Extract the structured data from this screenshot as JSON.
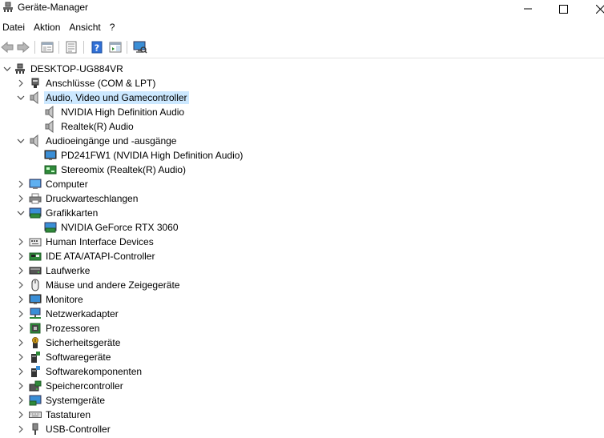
{
  "window": {
    "title": "Geräte-Manager"
  },
  "menu": [
    "Datei",
    "Aktion",
    "Ansicht",
    "?"
  ],
  "tree": {
    "root": "DESKTOP-UG884VR",
    "categories": [
      {
        "label": "Anschlüsse (COM & LPT)",
        "icon": "port-icon",
        "expanded": false
      },
      {
        "label": "Audio, Video und Gamecontroller",
        "icon": "speaker-icon",
        "expanded": true,
        "selected": true,
        "children": [
          {
            "label": "NVIDIA High Definition Audio",
            "icon": "speaker-icon"
          },
          {
            "label": "Realtek(R) Audio",
            "icon": "speaker-icon"
          }
        ]
      },
      {
        "label": "Audioeingänge und -ausgänge",
        "icon": "speaker-icon",
        "expanded": true,
        "children": [
          {
            "label": "PD241FW1 (NVIDIA High Definition Audio)",
            "icon": "monitor-icon"
          },
          {
            "label": "Stereomix (Realtek(R) Audio)",
            "icon": "audio-device-icon"
          }
        ]
      },
      {
        "label": "Computer",
        "icon": "computer-icon",
        "expanded": false
      },
      {
        "label": "Druckwarteschlangen",
        "icon": "printer-icon",
        "expanded": false
      },
      {
        "label": "Grafikkarten",
        "icon": "display-adapter-icon",
        "expanded": true,
        "children": [
          {
            "label": "NVIDIA GeForce RTX 3060",
            "icon": "display-adapter-icon"
          }
        ]
      },
      {
        "label": "Human Interface Devices",
        "icon": "hid-icon",
        "expanded": false
      },
      {
        "label": "IDE ATA/ATAPI-Controller",
        "icon": "ide-controller-icon",
        "expanded": false
      },
      {
        "label": "Laufwerke",
        "icon": "disk-drive-icon",
        "expanded": false
      },
      {
        "label": "Mäuse und andere Zeigegeräte",
        "icon": "mouse-icon",
        "expanded": false
      },
      {
        "label": "Monitore",
        "icon": "monitor-icon",
        "expanded": false
      },
      {
        "label": "Netzwerkadapter",
        "icon": "network-adapter-icon",
        "expanded": false
      },
      {
        "label": "Prozessoren",
        "icon": "processor-icon",
        "expanded": false
      },
      {
        "label": "Sicherheitsgeräte",
        "icon": "security-device-icon",
        "expanded": false
      },
      {
        "label": "Softwaregeräte",
        "icon": "software-device-icon",
        "expanded": false
      },
      {
        "label": "Softwarekomponenten",
        "icon": "software-component-icon",
        "expanded": false
      },
      {
        "label": "Speichercontroller",
        "icon": "storage-controller-icon",
        "expanded": false
      },
      {
        "label": "Systemgeräte",
        "icon": "system-device-icon",
        "expanded": false
      },
      {
        "label": "Tastaturen",
        "icon": "keyboard-icon",
        "expanded": false
      },
      {
        "label": "USB-Controller",
        "icon": "usb-icon",
        "expanded": false
      }
    ]
  },
  "colors": {
    "selection": "#cce8ff",
    "toolbar_help": "#2f6fd6"
  }
}
